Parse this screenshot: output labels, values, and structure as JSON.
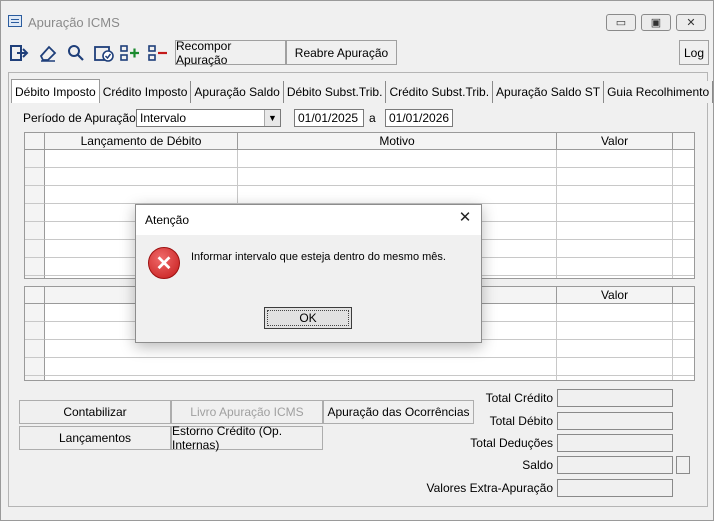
{
  "window": {
    "title": "Apuração ICMS",
    "minimize_glyph": "▭",
    "maximize_glyph": "▣",
    "close_glyph": "✕"
  },
  "toolbar": {
    "icons": [
      "exit-icon",
      "eraser-icon",
      "search-icon",
      "calendar-check-icon",
      "add-row-icon",
      "remove-row-icon"
    ],
    "recompor_label": "Recompor Apuração",
    "reabre_label": "Reabre Apuração",
    "log_label": "Log"
  },
  "tabs": [
    {
      "label": "Débito Imposto",
      "active": true
    },
    {
      "label": "Crédito Imposto"
    },
    {
      "label": "Apuração Saldo"
    },
    {
      "label": "Débito Subst.Trib."
    },
    {
      "label": "Crédito Subst.Trib."
    },
    {
      "label": "Apuração Saldo ST"
    },
    {
      "label": "Guia Recolhimento"
    }
  ],
  "period": {
    "label": "Período de  Apuração",
    "type_value": "Intervalo",
    "start": "01/01/2025",
    "separator": "a",
    "end": "01/01/2026"
  },
  "grid_debit": {
    "columns": [
      "Lançamento de Débito",
      "Motivo",
      "Valor"
    ]
  },
  "grid_second": {
    "columns": [
      "Valor"
    ]
  },
  "buttons": {
    "contabilizar": "Contabilizar",
    "livro": "Livro Apuração ICMS",
    "apuracao_ocorrencias": "Apuração das Ocorrências",
    "lancamentos": "Lançamentos",
    "estorno": "Estorno Crédito (Op. Internas)"
  },
  "totals": {
    "credito": "Total Crédito",
    "debito": "Total Débito",
    "deducoes": "Total Deduções",
    "saldo": "Saldo",
    "extra": "Valores Extra-Apuração"
  },
  "dialog": {
    "title": "Atenção",
    "close_glyph": "✕",
    "icon": "error-icon",
    "icon_glyph": "✕",
    "message": "Informar intervalo que esteja dentro do mesmo mês.",
    "ok_label": "OK"
  }
}
